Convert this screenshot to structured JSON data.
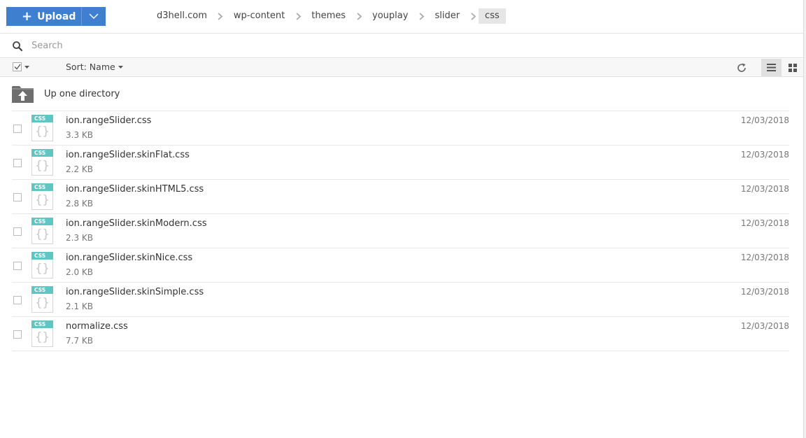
{
  "upload": {
    "label": "Upload"
  },
  "breadcrumb": [
    "d3hell.com",
    "wp-content",
    "themes",
    "youplay",
    "slider"
  ],
  "breadcrumb_current": "css",
  "search": {
    "placeholder": "Search",
    "value": ""
  },
  "toolbar": {
    "sort_label": "Sort: Name"
  },
  "up_directory": {
    "label": "Up one directory"
  },
  "icons": {
    "upload": "plus-icon",
    "dropdown": "chevron-down-icon",
    "separator": "chevron-right-icon",
    "search": "search-icon",
    "refresh": "refresh-icon",
    "list_view": "list-view-icon",
    "grid_view": "grid-view-icon",
    "folder_up": "folder-up-icon",
    "file": "css-file-icon"
  },
  "colors": {
    "accent": "#3f7fd0",
    "css_badge": "#5fc6c3"
  },
  "file_type_label": "CSS",
  "files": [
    {
      "name": "ion.rangeSlider.css",
      "size": "3.3 KB",
      "date": "12/03/2018"
    },
    {
      "name": "ion.rangeSlider.skinFlat.css",
      "size": "2.2 KB",
      "date": "12/03/2018"
    },
    {
      "name": "ion.rangeSlider.skinHTML5.css",
      "size": "2.8 KB",
      "date": "12/03/2018"
    },
    {
      "name": "ion.rangeSlider.skinModern.css",
      "size": "2.3 KB",
      "date": "12/03/2018"
    },
    {
      "name": "ion.rangeSlider.skinNice.css",
      "size": "2.0 KB",
      "date": "12/03/2018"
    },
    {
      "name": "ion.rangeSlider.skinSimple.css",
      "size": "2.1 KB",
      "date": "12/03/2018"
    },
    {
      "name": "normalize.css",
      "size": "7.7 KB",
      "date": "12/03/2018"
    }
  ]
}
